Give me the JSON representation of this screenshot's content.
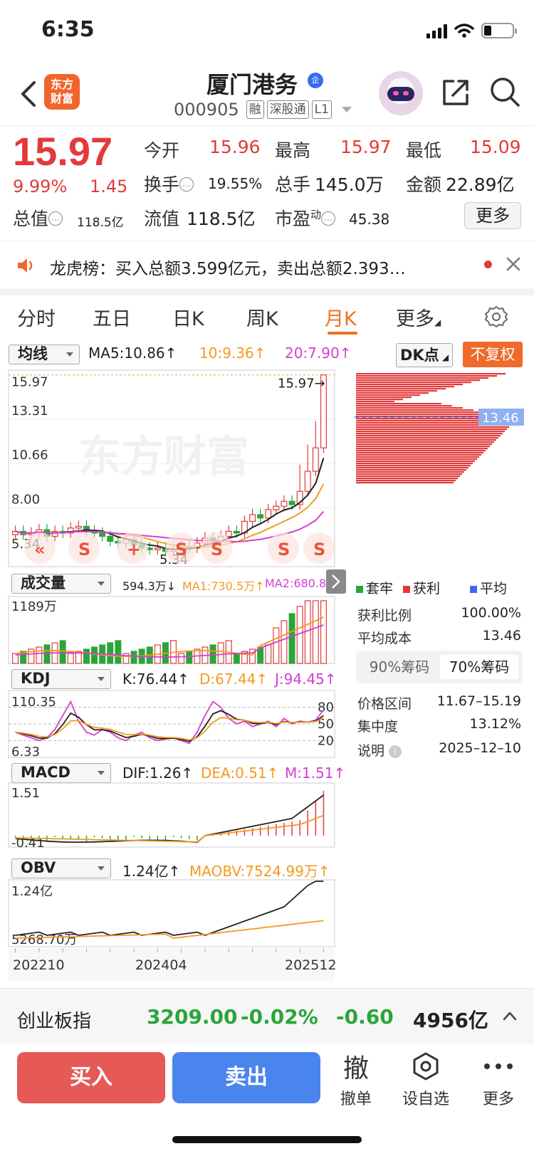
{
  "status": {
    "time": "6:35"
  },
  "header": {
    "brand_logo_text": "东方\n财富",
    "stock_name": "厦门港务",
    "badge": "企",
    "stock_code": "000905",
    "tags": [
      "融",
      "深股通",
      "L1"
    ]
  },
  "quote": {
    "price": "15.97",
    "change_pct": "9.99%",
    "change_amt": "1.45",
    "fields": {
      "open_label": "今开",
      "open": "15.96",
      "high_label": "最高",
      "high": "15.97",
      "low_label": "最低",
      "low": "15.09",
      "turnover_label": "换手",
      "turnover": "19.55%",
      "volume_label": "总手",
      "volume": "145.0万",
      "amount_label": "金额",
      "amount": "22.89亿",
      "total_mv_label": "总值",
      "total_mv": "118.5亿",
      "float_mv_label": "流值",
      "float_mv": "118.5亿",
      "pe_label": "市盈",
      "pe_sup": "动",
      "pe": "45.38"
    },
    "more_label": "更多"
  },
  "notice": {
    "text": "龙虎榜：买入总额3.599亿元，卖出总额2.393…"
  },
  "tabs": [
    {
      "label": "分时",
      "active": false
    },
    {
      "label": "五日",
      "active": false
    },
    {
      "label": "日K",
      "active": false
    },
    {
      "label": "周K",
      "active": false
    },
    {
      "label": "月K",
      "active": true
    },
    {
      "label": "更多",
      "active": false
    }
  ],
  "kline": {
    "ma_select": "均线",
    "ma5": "MA5:10.86↑",
    "ma10": "10:9.36↑",
    "ma20": "20:7.90↑",
    "dk_label": "DK点",
    "fuquan_label": "不复权",
    "y_labels": [
      "15.97",
      "13.31",
      "10.66",
      "8.00",
      "5.34"
    ],
    "max_marker": "15.97→",
    "min_marker": "5.34",
    "watermark": "东方财富",
    "signals": [
      "«",
      "S",
      "+",
      "S",
      "S",
      "S",
      "S"
    ],
    "chip_price": "13.46"
  },
  "volume": {
    "select": "成交量",
    "value": "594.3万↓",
    "ma1": "MA1:730.5万↑",
    "ma2": "MA2:680.8…",
    "y_label": "1189万"
  },
  "kdj": {
    "select": "KDJ",
    "k": "K:76.44↑",
    "d": "D:67.44↑",
    "j": "J:94.45↑",
    "y_top": "110.35",
    "y_bottom": "6.33",
    "levels": [
      "80",
      "50",
      "20"
    ]
  },
  "macd": {
    "select": "MACD",
    "dif": "DIF:1.26↑",
    "dea": "DEA:0.51↑",
    "m": "M:1.51↑",
    "y_top": "1.51",
    "y_bottom": "-0.41"
  },
  "obv": {
    "select": "OBV",
    "value": "1.24亿↑",
    "maobv": "MAOBV:7524.99万↑",
    "y_top": "1.24亿",
    "y_bottom": "5268.70万"
  },
  "x_labels": [
    "202210",
    "202404",
    "202512"
  ],
  "chip": {
    "legend": [
      {
        "label": "套牢",
        "color": "#2aa53a"
      },
      {
        "label": "获利",
        "color": "#e23a3a"
      },
      {
        "label": "平均",
        "color": "#3a6cf0"
      }
    ],
    "profit_ratio_label": "获利比例",
    "profit_ratio": "100.00%",
    "avg_cost_label": "平均成本",
    "avg_cost": "13.46",
    "tab_90": "90%筹码",
    "tab_70": "70%筹码",
    "range_label": "价格区间",
    "range": "11.67–15.19",
    "concentration_label": "集中度",
    "concentration": "13.12%",
    "note_label": "说明",
    "note_date": "2025–12–10"
  },
  "index_bar": {
    "name": "创业板指",
    "point": "3209.00",
    "pct": "-0.02%",
    "chg": "-0.60",
    "amount": "4956亿"
  },
  "actions": {
    "buy": "买入",
    "sell": "卖出",
    "cancel_icon_char": "撤",
    "cancel": "撤单",
    "watchlist": "设自选",
    "more": "更多"
  },
  "colors": {
    "up": "#e23a3a",
    "down": "#2aa53a",
    "accent": "#f07020",
    "buy": "#e55a56",
    "sell": "#4a85ee"
  }
}
